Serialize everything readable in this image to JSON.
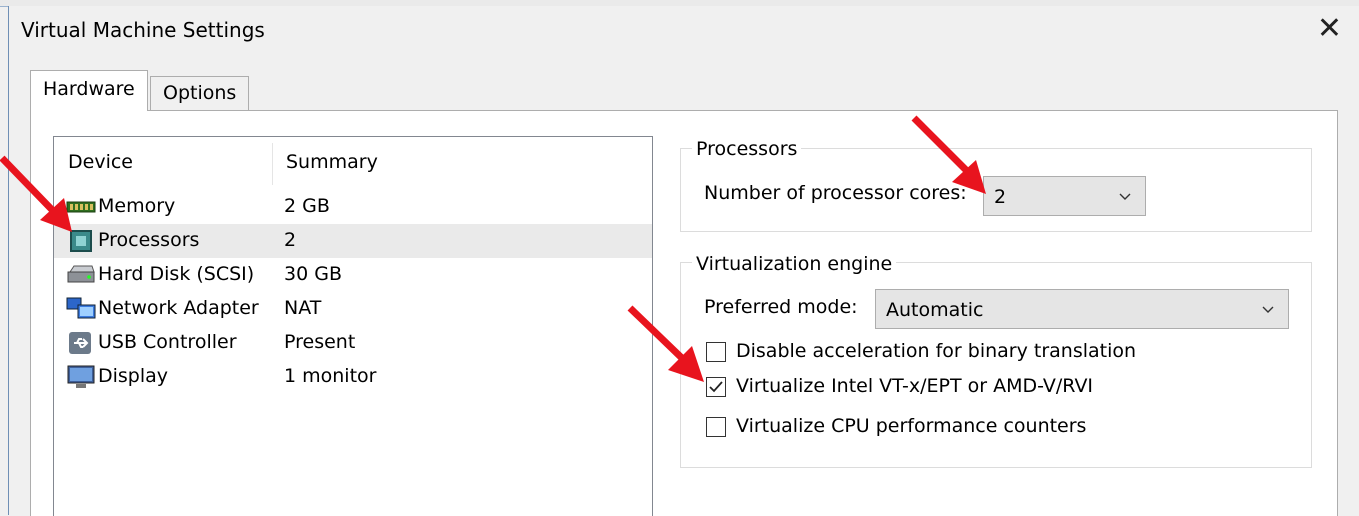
{
  "window": {
    "title": "Virtual Machine Settings",
    "close_glyph": "✕"
  },
  "tabs": [
    {
      "label": "Hardware"
    },
    {
      "label": "Options"
    }
  ],
  "device_list": {
    "headers": {
      "device": "Device",
      "summary": "Summary"
    },
    "rows": [
      {
        "device": "Memory",
        "summary": "2 GB",
        "icon": "memory-icon"
      },
      {
        "device": "Processors",
        "summary": "2",
        "icon": "processor-icon"
      },
      {
        "device": "Hard Disk (SCSI)",
        "summary": "30 GB",
        "icon": "hard-disk-icon"
      },
      {
        "device": "Network Adapter",
        "summary": "NAT",
        "icon": "network-adapter-icon"
      },
      {
        "device": "USB Controller",
        "summary": "Present",
        "icon": "usb-icon"
      },
      {
        "device": "Display",
        "summary": "1 monitor",
        "icon": "display-icon"
      }
    ],
    "selected_index": 1
  },
  "processors": {
    "group_label": "Processors",
    "cores_label": "Number of processor cores:",
    "cores_value": "2"
  },
  "virtualization": {
    "group_label": "Virtualization engine",
    "mode_label": "Preferred mode:",
    "mode_value": "Automatic",
    "options": [
      {
        "label": "Disable acceleration for binary translation",
        "checked": false
      },
      {
        "label": "Virtualize Intel VT-x/EPT or AMD-V/RVI",
        "checked": true
      },
      {
        "label": "Virtualize CPU performance counters",
        "checked": false
      }
    ]
  },
  "colors": {
    "annotation_arrow": "#e8141e",
    "selection": "#eaeaea"
  }
}
